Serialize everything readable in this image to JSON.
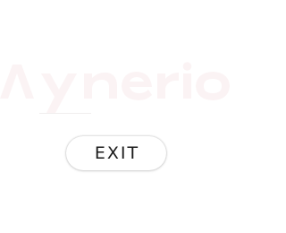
{
  "brand": {
    "logo_text": "Synerio",
    "logo_color": "#fbf3f4"
  },
  "actions": {
    "exit_label": "EXIT"
  },
  "colors": {
    "background": "#ffffff",
    "button_text": "#1a1a1a"
  }
}
